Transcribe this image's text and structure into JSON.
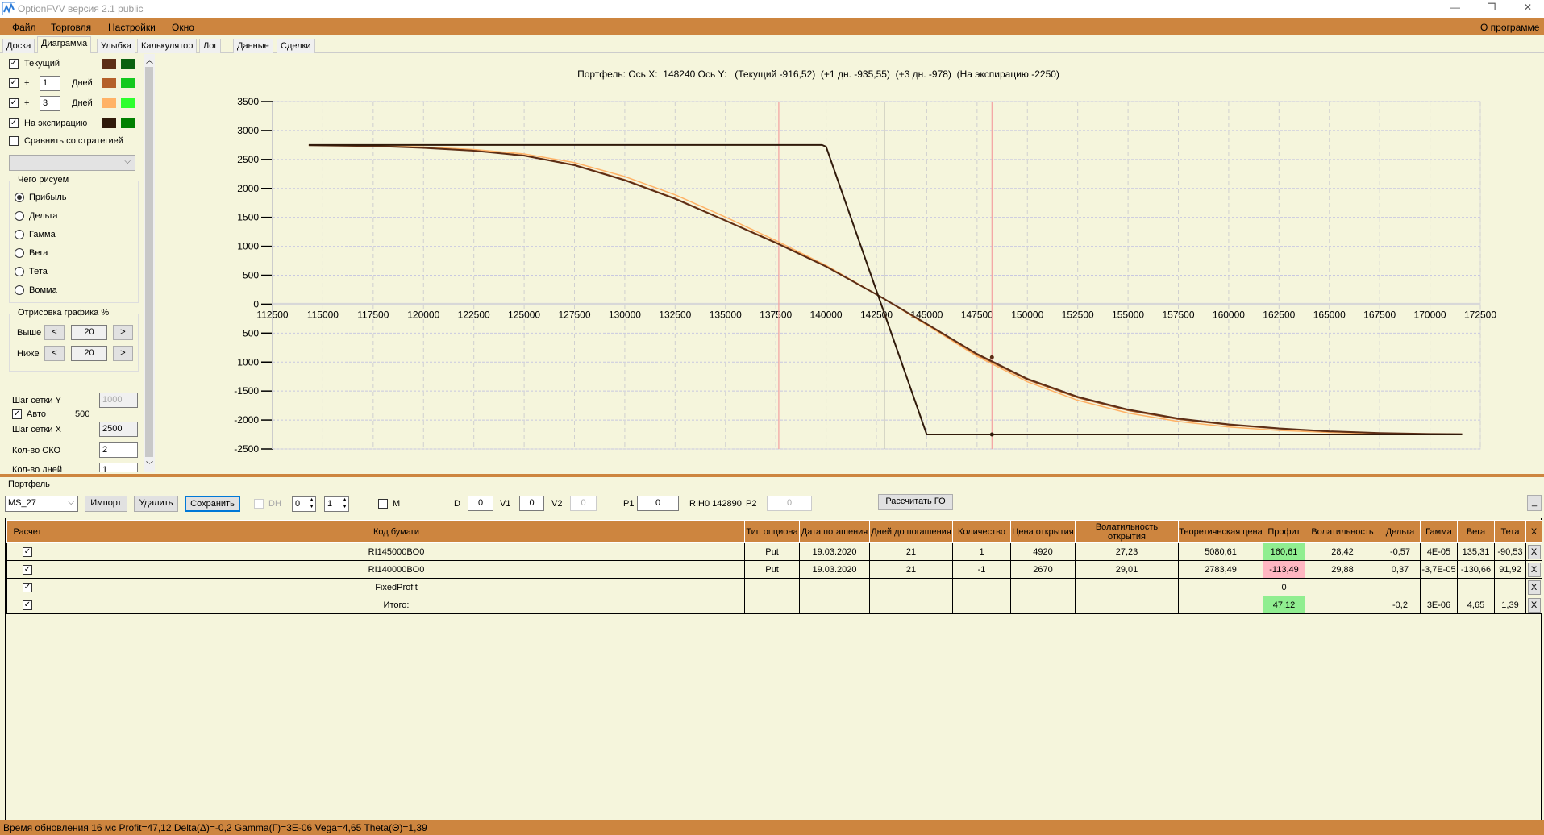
{
  "window": {
    "title": "OptionFVV версия 2.1 public",
    "minimize": "—",
    "restore": "❐",
    "close": "✕"
  },
  "menu": {
    "items": [
      "Файл",
      "Торговля",
      "Настройки",
      "Окно"
    ],
    "about": "О программе"
  },
  "tabs": [
    "Доска",
    "Диаграмма",
    "Улыбка",
    "Калькулятор",
    "Лог",
    "Данные",
    "Сделки"
  ],
  "active_tab": "Диаграмма",
  "left_panel": {
    "series": [
      {
        "label": "Текущий",
        "checked": true,
        "colors": [
          "#5C2E16",
          "#0A6010"
        ]
      },
      {
        "label": "+",
        "days": "1",
        "unit": "Дней",
        "checked": true,
        "colors": [
          "#B4602A",
          "#14C81E"
        ]
      },
      {
        "label": "+",
        "days": "3",
        "unit": "Дней",
        "checked": true,
        "colors": [
          "#FFB266",
          "#2EFF2E"
        ]
      },
      {
        "label": "На экспирацию",
        "checked": true,
        "colors": [
          "#301A0A",
          "#008000"
        ]
      }
    ],
    "compare_label": "Сравнить со стратегией",
    "compare_checked": false,
    "draw_group": "Чего рисуем",
    "draw_options": [
      "Прибыль",
      "Дельта",
      "Гамма",
      "Вега",
      "Тета",
      "Вомма"
    ],
    "draw_selected": "Прибыль",
    "render_group": "Отрисовка графика %",
    "above_label": "Выше",
    "above_value": "20",
    "below_label": "Ниже",
    "below_value": "20",
    "dec": "<",
    "inc": ">",
    "grid_y_label": "Шаг сетки Y",
    "grid_y_value": "1000",
    "auto_label": "Авто",
    "auto_checked": true,
    "auto_value": "500",
    "grid_x_label": "Шаг сетки X",
    "grid_x_value": "2500",
    "sko_label": "Кол-во СКО",
    "sko_value": "2",
    "days_label": "Кол-во дней",
    "days_value": "1"
  },
  "chart_header": "Портфель: Ось X:  148240 Ось Y:   (Текущий -916,52)  (+1 дн. -935,55)  (+3 дн. -978)  (На экспирацию -2250)",
  "chart_data": {
    "type": "line",
    "xlim": [
      112500,
      172500
    ],
    "ylim": [
      -2500,
      3500
    ],
    "x_ticks": [
      112500,
      115000,
      117500,
      120000,
      122500,
      125000,
      127500,
      130000,
      132500,
      135000,
      137500,
      140000,
      142500,
      145000,
      147500,
      150000,
      152500,
      155000,
      157500,
      160000,
      162500,
      165000,
      167500,
      170000,
      172500
    ],
    "y_ticks": [
      -2500,
      -2000,
      -1500,
      -1000,
      -500,
      0,
      500,
      1000,
      1500,
      2000,
      2500,
      3000,
      3500
    ],
    "grid": true,
    "vlines": [
      {
        "x": 137650,
        "color": "#F4A0A0"
      },
      {
        "x": 142890,
        "color": "#999999"
      },
      {
        "x": 148240,
        "color": "#F4A0A0"
      }
    ],
    "markers": [
      {
        "x": 148240,
        "y": -916.52,
        "color": "#5C2E16"
      },
      {
        "x": 148240,
        "y": -2250,
        "color": "#301A0A"
      }
    ],
    "series": [
      {
        "name": "+3 дн.",
        "color": "#FFB266",
        "x": [
          114300,
          117500,
          120000,
          122500,
          125000,
          127500,
          130000,
          132500,
          135000,
          137500,
          140000,
          142500,
          145000,
          147500,
          150000,
          152500,
          155000,
          157500,
          160000,
          162500,
          165000,
          167500,
          170000,
          171600
        ],
        "y": [
          2748,
          2738,
          2715,
          2672,
          2595,
          2445,
          2205,
          1890,
          1505,
          1100,
          670,
          170,
          -360,
          -900,
          -1340,
          -1660,
          -1880,
          -2025,
          -2120,
          -2180,
          -2215,
          -2235,
          -2245,
          -2248
        ]
      },
      {
        "name": "+1 дн.",
        "color": "#B4602A",
        "x": [
          114300,
          117500,
          120000,
          122500,
          125000,
          127500,
          130000,
          132500,
          135000,
          137500,
          140000,
          142500,
          145000,
          147500,
          150000,
          152500,
          155000,
          157500,
          160000,
          162500,
          165000,
          167500,
          170000,
          171600
        ],
        "y": [
          2746,
          2732,
          2703,
          2655,
          2570,
          2408,
          2150,
          1828,
          1450,
          1068,
          655,
          170,
          -345,
          -875,
          -1305,
          -1615,
          -1835,
          -1988,
          -2085,
          -2152,
          -2200,
          -2228,
          -2242,
          -2246
        ]
      },
      {
        "name": "Текущий",
        "color": "#5C2E16",
        "x": [
          114300,
          117500,
          120000,
          122500,
          125000,
          127500,
          130000,
          132500,
          135000,
          137500,
          140000,
          142500,
          145000,
          147500,
          150000,
          152500,
          155000,
          157500,
          160000,
          162500,
          165000,
          167500,
          170000,
          171600
        ],
        "y": [
          2745,
          2730,
          2700,
          2650,
          2565,
          2400,
          2140,
          1820,
          1443,
          1060,
          650,
          170,
          -340,
          -860,
          -1290,
          -1600,
          -1820,
          -1975,
          -2075,
          -2145,
          -2195,
          -2225,
          -2240,
          -2245
        ]
      },
      {
        "name": "На экспирацию",
        "color": "#301A0A",
        "x": [
          114300,
          139800,
          140000,
          145000,
          171600
        ],
        "y": [
          2750,
          2750,
          2720,
          -2250,
          -2250
        ]
      }
    ]
  },
  "portfolio": {
    "group": "Портфель",
    "name": "MS_27",
    "import": "Импорт",
    "delete": "Удалить",
    "save": "Сохранить",
    "dh_label": "DH",
    "spin1": "0",
    "spin2": "1",
    "m_label": "M",
    "d_label": "D",
    "d_value": "0",
    "v1_label": "V1",
    "v1_value": "0",
    "v2_label": "V2",
    "v2_value": "0",
    "p1_label": "P1",
    "p1_value": "0",
    "rih": "RIH0 142890",
    "p2_label": "P2",
    "p2_value": "0",
    "calc_go": "Рассчитать ГО",
    "min": "_"
  },
  "table": {
    "headers": [
      "Расчет",
      "Код бумаги",
      "Тип опциона",
      "Дата погашения",
      "Дней до погашения",
      "Количество",
      "Цена открытия",
      "Волатильность открытия",
      "Теоретическая цена",
      "Профит",
      "Волатильность",
      "Дельта",
      "Гамма",
      "Вега",
      "Тета",
      "X"
    ],
    "rows": [
      {
        "cells": [
          "RI145000BO0",
          "Put",
          "19.03.2020",
          "21",
          "1",
          "4920",
          "27,23",
          "5080,61",
          "160,61",
          "28,42",
          "-0,57",
          "4E-05",
          "135,31",
          "-90,53"
        ],
        "profit_state": "pos"
      },
      {
        "cells": [
          "RI140000BO0",
          "Put",
          "19.03.2020",
          "21",
          "-1",
          "2670",
          "29,01",
          "2783,49",
          "-113,49",
          "29,88",
          "0,37",
          "-3,7E-05",
          "-130,66",
          "91,92"
        ],
        "profit_state": "neg"
      },
      {
        "cells": [
          "FixedProfit",
          "",
          "",
          "",
          "",
          "",
          "",
          "",
          "0",
          "",
          "",
          "",
          "",
          ""
        ],
        "profit_state": ""
      },
      {
        "cells": [
          "Итого:",
          "",
          "",
          "",
          "",
          "",
          "",
          "",
          "47,12",
          "",
          "-0,2",
          "3E-06",
          "4,65",
          "1,39"
        ],
        "profit_state": "pos"
      }
    ],
    "check": "✓",
    "delete": "X"
  },
  "status": "Время обновления 16 мс  Profit=47,12 Delta(Δ)=-0,2 Gamma(Γ)=3E-06 Vega=4,65 Theta(Θ)=1,39"
}
